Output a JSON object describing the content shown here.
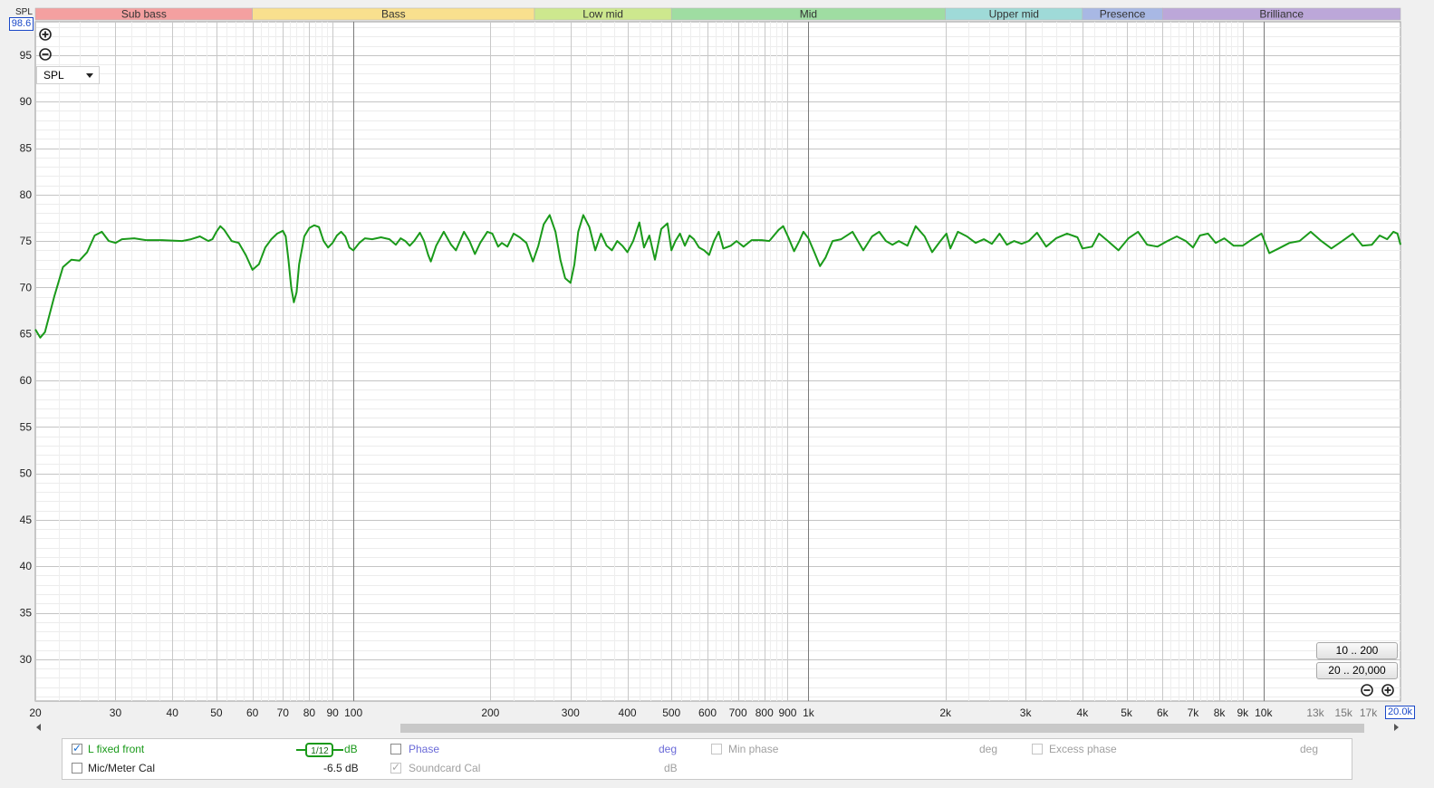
{
  "corner_label": "SPL",
  "y_max_box": "98.6",
  "x_max_box": "20.0k",
  "dropdown": {
    "selected": "SPL"
  },
  "range_buttons": [
    "10 .. 200",
    "20 .. 20,000"
  ],
  "colors": {
    "trace": "#1a9a1a",
    "grid": "#d0d0d0",
    "grid_major": "#7a7a7a",
    "accent_blue": "#1a48c8"
  },
  "icons": {
    "zoom_in": "zoom-in-icon",
    "zoom_out": "zoom-out-icon"
  },
  "legend": {
    "row1": {
      "name": "L fixed front",
      "checked": true,
      "smoothing": "1/12",
      "unit": "dB",
      "phase_label": "Phase",
      "phase_unit": "deg",
      "min_phase_label": "Min phase",
      "min_phase_unit": "deg",
      "excess_phase_label": "Excess phase",
      "excess_phase_unit": "deg"
    },
    "row2": {
      "name": "Mic/Meter Cal",
      "checked": false,
      "value": "-6.5 dB",
      "soundcard_label": "Soundcard Cal",
      "soundcard_checked": true,
      "soundcard_unit": "dB"
    }
  },
  "chart_data": {
    "type": "line",
    "x_scale": "log",
    "xlim": [
      20,
      20000
    ],
    "ylim": [
      25.5,
      98.6
    ],
    "ylabel": "SPL",
    "y_ticks": [
      95,
      90,
      85,
      80,
      75,
      70,
      65,
      60,
      55,
      50,
      45,
      40,
      35,
      30
    ],
    "x_ticks": [
      {
        "v": 20,
        "t": "20"
      },
      {
        "v": 30,
        "t": "30"
      },
      {
        "v": 40,
        "t": "40"
      },
      {
        "v": 50,
        "t": "50"
      },
      {
        "v": 60,
        "t": "60"
      },
      {
        "v": 70,
        "t": "70"
      },
      {
        "v": 80,
        "t": "80"
      },
      {
        "v": 90,
        "t": "90"
      },
      {
        "v": 100,
        "t": "100"
      },
      {
        "v": 200,
        "t": "200"
      },
      {
        "v": 300,
        "t": "300"
      },
      {
        "v": 400,
        "t": "400"
      },
      {
        "v": 500,
        "t": "500"
      },
      {
        "v": 600,
        "t": "600"
      },
      {
        "v": 700,
        "t": "700"
      },
      {
        "v": 800,
        "t": "800"
      },
      {
        "v": 900,
        "t": "900"
      },
      {
        "v": 1000,
        "t": "1k"
      },
      {
        "v": 2000,
        "t": "2k"
      },
      {
        "v": 3000,
        "t": "3k"
      },
      {
        "v": 4000,
        "t": "4k"
      },
      {
        "v": 5000,
        "t": "5k"
      },
      {
        "v": 6000,
        "t": "6k"
      },
      {
        "v": 7000,
        "t": "7k"
      },
      {
        "v": 8000,
        "t": "8k"
      },
      {
        "v": 9000,
        "t": "9k"
      },
      {
        "v": 10000,
        "t": "10k"
      },
      {
        "v": 13000,
        "t": "13k"
      },
      {
        "v": 15000,
        "t": "15k"
      },
      {
        "v": 17000,
        "t": "17k"
      }
    ],
    "bands": [
      {
        "name": "Sub bass",
        "from": 20,
        "to": 60,
        "color": "#f4a0a0"
      },
      {
        "name": "Bass",
        "from": 60,
        "to": 250,
        "color": "#f9e08e"
      },
      {
        "name": "Low mid",
        "from": 250,
        "to": 500,
        "color": "#cde88e"
      },
      {
        "name": "Mid",
        "from": 500,
        "to": 2000,
        "color": "#9fdda2"
      },
      {
        "name": "Upper mid",
        "from": 2000,
        "to": 4000,
        "color": "#9fdad8"
      },
      {
        "name": "Presence",
        "from": 4000,
        "to": 6000,
        "color": "#a8b8e4"
      },
      {
        "name": "Brilliance",
        "from": 6000,
        "to": 20000,
        "color": "#bca7d9"
      }
    ],
    "series": [
      {
        "color": "#1a9a1a",
        "points": [
          [
            20,
            65.5
          ],
          [
            20.5,
            64.6
          ],
          [
            21,
            65.2
          ],
          [
            22,
            69.0
          ],
          [
            23,
            72.2
          ],
          [
            24,
            73.0
          ],
          [
            25,
            72.9
          ],
          [
            26,
            73.8
          ],
          [
            27,
            75.6
          ],
          [
            28,
            76.0
          ],
          [
            29,
            75.0
          ],
          [
            30,
            74.8
          ],
          [
            31,
            75.2
          ],
          [
            33,
            75.3
          ],
          [
            35,
            75.1
          ],
          [
            38,
            75.1
          ],
          [
            42,
            75.0
          ],
          [
            44,
            75.2
          ],
          [
            46,
            75.5
          ],
          [
            48,
            75.0
          ],
          [
            49,
            75.2
          ],
          [
            50,
            76.0
          ],
          [
            51,
            76.6
          ],
          [
            52,
            76.2
          ],
          [
            54,
            75.0
          ],
          [
            56,
            74.8
          ],
          [
            58,
            73.5
          ],
          [
            60,
            71.9
          ],
          [
            62,
            72.5
          ],
          [
            64,
            74.3
          ],
          [
            66,
            75.2
          ],
          [
            68,
            75.8
          ],
          [
            70,
            76.1
          ],
          [
            71,
            75.5
          ],
          [
            72,
            73.0
          ],
          [
            73,
            70.0
          ],
          [
            74,
            68.4
          ],
          [
            75,
            69.5
          ],
          [
            76,
            72.5
          ],
          [
            78,
            75.5
          ],
          [
            80,
            76.4
          ],
          [
            82,
            76.7
          ],
          [
            84,
            76.5
          ],
          [
            86,
            75.0
          ],
          [
            88,
            74.3
          ],
          [
            90,
            74.8
          ],
          [
            92,
            75.6
          ],
          [
            94,
            76.0
          ],
          [
            96,
            75.5
          ],
          [
            98,
            74.3
          ],
          [
            100,
            74.0
          ],
          [
            103,
            74.8
          ],
          [
            106,
            75.3
          ],
          [
            110,
            75.2
          ],
          [
            115,
            75.4
          ],
          [
            120,
            75.2
          ],
          [
            124,
            74.6
          ],
          [
            127,
            75.3
          ],
          [
            130,
            75.0
          ],
          [
            133,
            74.5
          ],
          [
            136,
            75.0
          ],
          [
            140,
            75.9
          ],
          [
            143,
            75.0
          ],
          [
            146,
            73.5
          ],
          [
            148,
            72.8
          ],
          [
            152,
            74.5
          ],
          [
            158,
            76.0
          ],
          [
            164,
            74.6
          ],
          [
            168,
            74.0
          ],
          [
            175,
            76.0
          ],
          [
            180,
            75.0
          ],
          [
            185,
            73.6
          ],
          [
            190,
            74.8
          ],
          [
            197,
            76.0
          ],
          [
            202,
            75.8
          ],
          [
            208,
            74.4
          ],
          [
            212,
            74.8
          ],
          [
            218,
            74.4
          ],
          [
            225,
            75.8
          ],
          [
            232,
            75.4
          ],
          [
            240,
            74.8
          ],
          [
            248,
            72.8
          ],
          [
            255,
            74.5
          ],
          [
            262,
            76.8
          ],
          [
            270,
            77.8
          ],
          [
            278,
            76.0
          ],
          [
            285,
            73.0
          ],
          [
            292,
            71.0
          ],
          [
            300,
            70.5
          ],
          [
            306,
            72.5
          ],
          [
            312,
            76.0
          ],
          [
            320,
            77.8
          ],
          [
            330,
            76.5
          ],
          [
            340,
            74.0
          ],
          [
            350,
            75.8
          ],
          [
            360,
            74.5
          ],
          [
            370,
            74.0
          ],
          [
            380,
            75.0
          ],
          [
            390,
            74.5
          ],
          [
            400,
            73.8
          ],
          [
            412,
            75.0
          ],
          [
            425,
            77.0
          ],
          [
            435,
            74.3
          ],
          [
            447,
            75.6
          ],
          [
            460,
            73.0
          ],
          [
            475,
            76.3
          ],
          [
            490,
            76.9
          ],
          [
            500,
            74.0
          ],
          [
            510,
            75.0
          ],
          [
            522,
            75.8
          ],
          [
            535,
            74.5
          ],
          [
            548,
            75.6
          ],
          [
            560,
            75.2
          ],
          [
            575,
            74.3
          ],
          [
            590,
            74.0
          ],
          [
            605,
            73.5
          ],
          [
            620,
            75.0
          ],
          [
            635,
            76.0
          ],
          [
            650,
            74.2
          ],
          [
            675,
            74.5
          ],
          [
            695,
            75.0
          ],
          [
            720,
            74.4
          ],
          [
            750,
            75.1
          ],
          [
            790,
            75.1
          ],
          [
            820,
            75.0
          ],
          [
            860,
            76.2
          ],
          [
            880,
            76.6
          ],
          [
            905,
            75.3
          ],
          [
            930,
            73.9
          ],
          [
            955,
            75.0
          ],
          [
            975,
            76.0
          ],
          [
            1000,
            75.3
          ],
          [
            1030,
            73.8
          ],
          [
            1060,
            72.3
          ],
          [
            1090,
            73.2
          ],
          [
            1130,
            75.0
          ],
          [
            1180,
            75.2
          ],
          [
            1250,
            76.0
          ],
          [
            1320,
            74.0
          ],
          [
            1380,
            75.5
          ],
          [
            1430,
            76.0
          ],
          [
            1480,
            75.0
          ],
          [
            1530,
            74.6
          ],
          [
            1580,
            75.0
          ],
          [
            1650,
            74.5
          ],
          [
            1720,
            76.6
          ],
          [
            1800,
            75.5
          ],
          [
            1870,
            73.8
          ],
          [
            1950,
            75.0
          ],
          [
            2010,
            75.8
          ],
          [
            2050,
            74.2
          ],
          [
            2130,
            76.0
          ],
          [
            2230,
            75.5
          ],
          [
            2330,
            74.8
          ],
          [
            2430,
            75.2
          ],
          [
            2530,
            74.7
          ],
          [
            2630,
            75.8
          ],
          [
            2730,
            74.6
          ],
          [
            2830,
            75.0
          ],
          [
            2940,
            74.7
          ],
          [
            3050,
            75.0
          ],
          [
            3180,
            75.9
          ],
          [
            3330,
            74.4
          ],
          [
            3500,
            75.3
          ],
          [
            3700,
            75.8
          ],
          [
            3900,
            75.4
          ],
          [
            4000,
            74.2
          ],
          [
            4200,
            74.4
          ],
          [
            4350,
            75.8
          ],
          [
            4550,
            75.0
          ],
          [
            4800,
            74.0
          ],
          [
            5050,
            75.3
          ],
          [
            5300,
            76.0
          ],
          [
            5550,
            74.6
          ],
          [
            5850,
            74.4
          ],
          [
            6150,
            75.0
          ],
          [
            6450,
            75.5
          ],
          [
            6750,
            75.0
          ],
          [
            7000,
            74.3
          ],
          [
            7250,
            75.6
          ],
          [
            7550,
            75.8
          ],
          [
            7850,
            74.8
          ],
          [
            8200,
            75.3
          ],
          [
            8600,
            74.5
          ],
          [
            9000,
            74.5
          ],
          [
            9450,
            75.2
          ],
          [
            9900,
            75.8
          ],
          [
            10300,
            73.7
          ],
          [
            10800,
            74.2
          ],
          [
            11400,
            74.8
          ],
          [
            12000,
            75.0
          ],
          [
            12700,
            76.0
          ],
          [
            13400,
            75.0
          ],
          [
            14100,
            74.2
          ],
          [
            14900,
            75.0
          ],
          [
            15700,
            75.8
          ],
          [
            16500,
            74.5
          ],
          [
            17300,
            74.6
          ],
          [
            18000,
            75.6
          ],
          [
            18700,
            75.2
          ],
          [
            19300,
            76.0
          ],
          [
            19700,
            75.8
          ],
          [
            20000,
            74.6
          ]
        ]
      }
    ]
  }
}
